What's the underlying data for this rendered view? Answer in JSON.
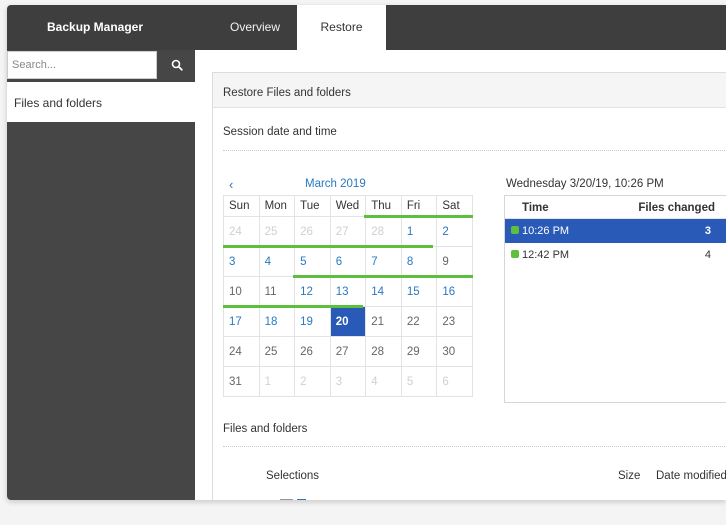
{
  "app": {
    "title": "Backup Manager"
  },
  "tabs": [
    {
      "label": "Overview",
      "active": false
    },
    {
      "label": "Restore",
      "active": true
    }
  ],
  "sidebar": {
    "search_placeholder": "Search...",
    "search_icon": "search-icon",
    "items": [
      {
        "label": "Files and folders",
        "selected": true
      }
    ]
  },
  "panel": {
    "title": "Restore Files and folders",
    "session_label": "Session date and time",
    "files_label": "Files and folders"
  },
  "calendar": {
    "prev_icon": "chevron-left-icon",
    "prev_glyph": "‹",
    "month": "March 2019",
    "weekdays": [
      "Sun",
      "Mon",
      "Tue",
      "Wed",
      "Thu",
      "Fri",
      "Sat"
    ],
    "weeks": [
      [
        {
          "d": "24",
          "s": "other"
        },
        {
          "d": "25",
          "s": "other"
        },
        {
          "d": "26",
          "s": "other"
        },
        {
          "d": "27",
          "s": "other"
        },
        {
          "d": "28",
          "s": "other"
        },
        {
          "d": "1",
          "s": "avail"
        },
        {
          "d": "2",
          "s": "avail"
        }
      ],
      [
        {
          "d": "3",
          "s": "avail"
        },
        {
          "d": "4",
          "s": "avail"
        },
        {
          "d": "5",
          "s": "avail"
        },
        {
          "d": "6",
          "s": "avail"
        },
        {
          "d": "7",
          "s": "avail"
        },
        {
          "d": "8",
          "s": "avail"
        },
        {
          "d": "9",
          "s": "plain"
        }
      ],
      [
        {
          "d": "10",
          "s": "plain"
        },
        {
          "d": "11",
          "s": "plain"
        },
        {
          "d": "12",
          "s": "avail"
        },
        {
          "d": "13",
          "s": "avail"
        },
        {
          "d": "14",
          "s": "avail"
        },
        {
          "d": "15",
          "s": "avail"
        },
        {
          "d": "16",
          "s": "avail"
        }
      ],
      [
        {
          "d": "17",
          "s": "avail"
        },
        {
          "d": "18",
          "s": "avail"
        },
        {
          "d": "19",
          "s": "avail"
        },
        {
          "d": "20",
          "s": "sel"
        },
        {
          "d": "21",
          "s": "plain"
        },
        {
          "d": "22",
          "s": "plain"
        },
        {
          "d": "23",
          "s": "plain"
        }
      ],
      [
        {
          "d": "24",
          "s": "plain"
        },
        {
          "d": "25",
          "s": "plain"
        },
        {
          "d": "26",
          "s": "plain"
        },
        {
          "d": "27",
          "s": "plain"
        },
        {
          "d": "28",
          "s": "plain"
        },
        {
          "d": "29",
          "s": "plain"
        },
        {
          "d": "30",
          "s": "plain"
        }
      ],
      [
        {
          "d": "31",
          "s": "plain"
        },
        {
          "d": "1",
          "s": "other"
        },
        {
          "d": "2",
          "s": "other"
        },
        {
          "d": "3",
          "s": "other"
        },
        {
          "d": "4",
          "s": "other"
        },
        {
          "d": "5",
          "s": "other"
        },
        {
          "d": "6",
          "s": "other"
        }
      ]
    ]
  },
  "sessions": {
    "title": "Wednesday 3/20/19, 10:26 PM",
    "columns": {
      "time": "Time",
      "files": "Files changed"
    },
    "rows": [
      {
        "time": "10:26 PM",
        "files": "3",
        "selected": true
      },
      {
        "time": "12:42 PM",
        "files": "4",
        "selected": false
      }
    ]
  },
  "files_table": {
    "columns": {
      "selections": "Selections",
      "size": "Size",
      "date_modified": "Date modified"
    }
  },
  "colors": {
    "topbar": "#3e3e3e",
    "sidebar": "#464646",
    "accent_blue": "#2a78c2",
    "selected_blue": "#2a5ab8",
    "backup_green": "#5cbf3e"
  }
}
